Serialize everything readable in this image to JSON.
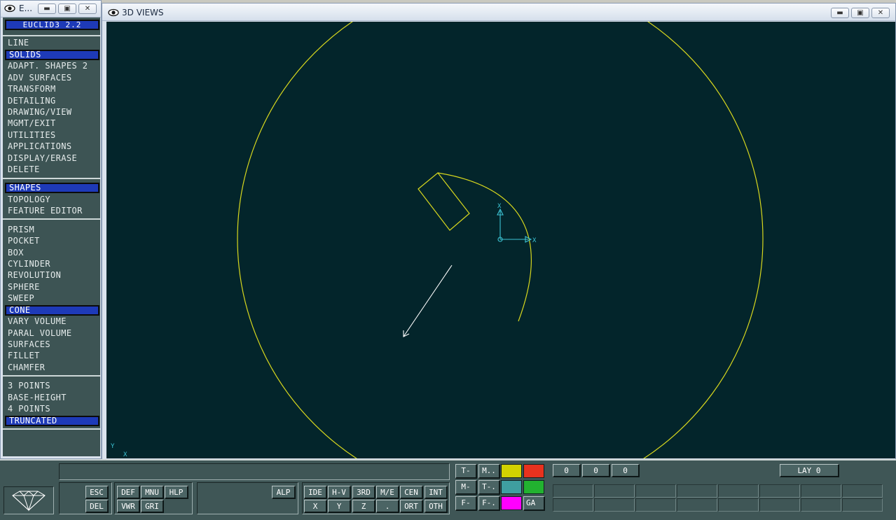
{
  "menu_window": {
    "title": "E...",
    "buttons": [
      "minimize",
      "restore",
      "close"
    ],
    "app_title": "EUCLID3 2.2",
    "groups": [
      [
        "LINE",
        "SOLIDS",
        "ADAPT. SHAPES 2",
        "ADV SURFACES",
        "TRANSFORM",
        "DETAILING",
        "DRAWING/VIEW",
        "MGMT/EXIT",
        "UTILITIES",
        "APPLICATIONS",
        "DISPLAY/ERASE",
        "DELETE"
      ],
      [
        "SHAPES",
        "TOPOLOGY",
        "FEATURE EDITOR"
      ],
      [
        "PRISM",
        "POCKET",
        "BOX",
        "CYLINDER",
        "REVOLUTION",
        "SPHERE",
        "SWEEP",
        "CONE",
        "VARY VOLUME",
        "PARAL VOLUME",
        "SURFACES",
        "FILLET",
        "CHAMFER"
      ],
      [
        "3 POINTS",
        "BASE-HEIGHT",
        "4 POINTS",
        "TRUNCATED"
      ]
    ],
    "selected_items": [
      "SOLIDS",
      "SHAPES",
      "CONE",
      "TRUNCATED"
    ]
  },
  "view_window": {
    "title": "3D VIEWS",
    "axis_labels": {
      "x": "X",
      "y": "Y",
      "corner_y": "Y",
      "corner_x": "X"
    },
    "colors": {
      "background": "#03252b",
      "geometry": "#d8d81e",
      "axis": "#3cc4d4",
      "vector": "#ffffff"
    }
  },
  "bottom_panel": {
    "group1": [
      "ESC",
      "DEL"
    ],
    "group2_row1": [
      "DEF",
      "MNU",
      "HLP"
    ],
    "group2_row2": [
      "VWR",
      "GRI"
    ],
    "alp": "ALP",
    "view_row1": [
      "IDE",
      "H-V",
      "3RD",
      "M/E",
      "CEN",
      "INT"
    ],
    "view_row2": [
      "X",
      "Y",
      "Z",
      ".",
      "ORT",
      "OTH"
    ],
    "mode_col1": [
      "T-",
      "M-",
      "F-"
    ],
    "mode_col2": [
      "M..",
      "T-.",
      "F-."
    ],
    "swatch_colors": [
      "#d2d200",
      "#e8321e",
      "#3f9ea0",
      "#22b230",
      "#ff00ff"
    ],
    "ga_label": "GA",
    "coords": [
      "0",
      "0",
      "0"
    ],
    "layer": "LAY 0"
  }
}
